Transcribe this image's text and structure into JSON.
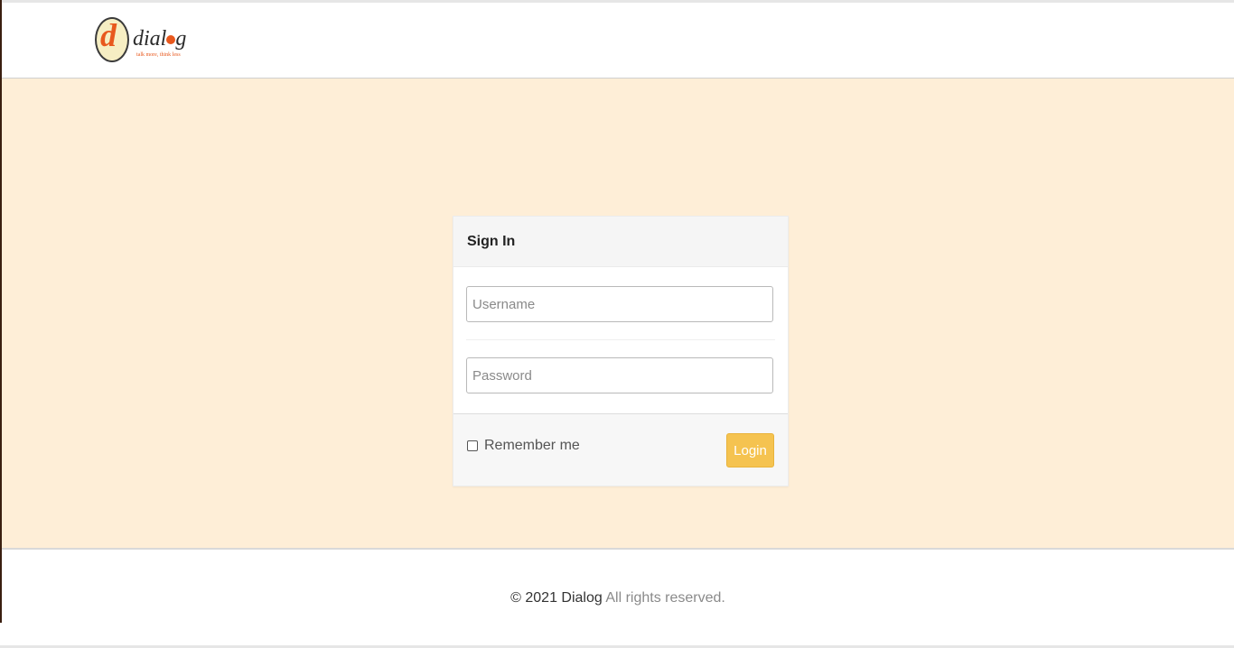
{
  "header": {
    "logo": {
      "letter": "d",
      "name_start": "dial",
      "name_end": "g",
      "tagline": "talk more, think less"
    }
  },
  "signin": {
    "title": "Sign In",
    "username_placeholder": "Username",
    "password_placeholder": "Password",
    "remember_label": "Remember me",
    "login_label": "Login"
  },
  "footer": {
    "copyright": "© 2021 Dialog",
    "rights": " All rights reserved."
  },
  "colors": {
    "background": "#feeed7",
    "login_button": "#f5c350",
    "logo_accent": "#e8581d"
  }
}
